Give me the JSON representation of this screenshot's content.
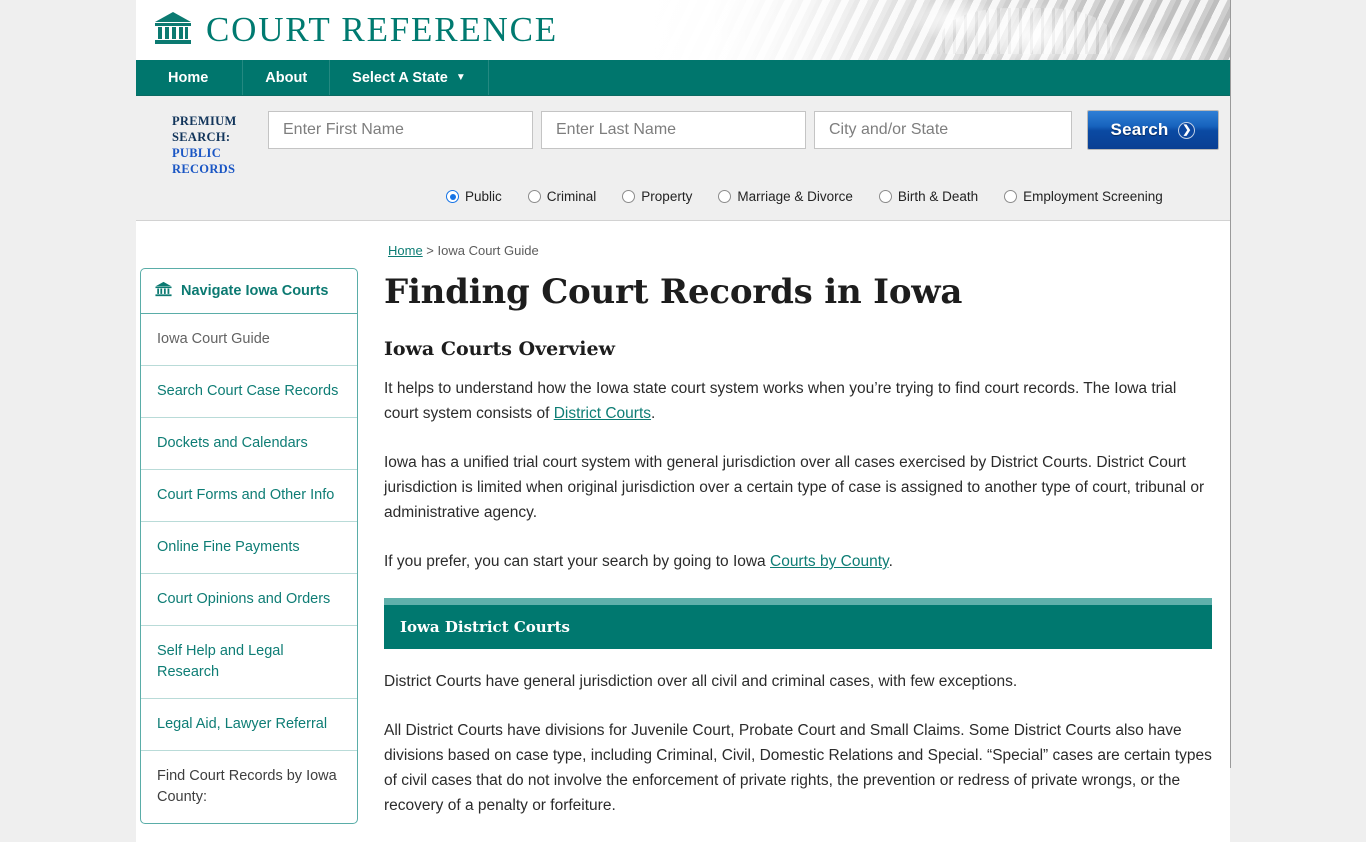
{
  "site": {
    "brand": "COURT REFERENCE",
    "brand_icon": "courthouse-icon"
  },
  "nav": {
    "items": [
      {
        "label": "Home"
      },
      {
        "label": "About"
      },
      {
        "label": "Select A State",
        "caret": "▼"
      }
    ]
  },
  "premium_search": {
    "label_line1": "PREMIUM",
    "label_line2": "SEARCH:",
    "label_line3": "PUBLIC",
    "label_line4": "RECORDS",
    "first_name_placeholder": "Enter First Name",
    "first_name_value": "",
    "last_name_placeholder": "Enter Last Name",
    "last_name_value": "",
    "city_state_placeholder": "City and/or State",
    "city_state_value": "",
    "search_button": "Search",
    "search_button_icon": "chevron-right-icon",
    "options": [
      {
        "label": "Public",
        "selected": true
      },
      {
        "label": "Criminal",
        "selected": false
      },
      {
        "label": "Property",
        "selected": false
      },
      {
        "label": "Marriage & Divorce",
        "selected": false
      },
      {
        "label": "Birth & Death",
        "selected": false
      },
      {
        "label": "Employment Screening",
        "selected": false
      }
    ]
  },
  "sidebar": {
    "heading": "Navigate Iowa Courts",
    "heading_icon": "courthouse-icon",
    "items": [
      {
        "label": "Iowa Court Guide",
        "state": "current"
      },
      {
        "label": "Search Court Case Records",
        "state": "link"
      },
      {
        "label": "Dockets and Calendars",
        "state": "link"
      },
      {
        "label": "Court Forms and Other Info",
        "state": "link"
      },
      {
        "label": "Online Fine Payments",
        "state": "link"
      },
      {
        "label": "Court Opinions and Orders",
        "state": "link"
      },
      {
        "label": "Self Help and Legal Research",
        "state": "link"
      },
      {
        "label": "Legal Aid, Lawyer Referral",
        "state": "link"
      },
      {
        "label": "Find Court Records by Iowa County:",
        "state": "plain"
      }
    ]
  },
  "breadcrumb": {
    "home": "Home",
    "separator": " > ",
    "current": "Iowa Court Guide"
  },
  "main": {
    "title": "Finding Court Records in Iowa",
    "overview_heading": "Iowa Courts Overview",
    "para1_before": "It helps to understand how the Iowa state court system works when you’re trying to find court records. The Iowa trial court system consists of ",
    "para1_link": "District Courts",
    "para1_after": ".",
    "para2": "Iowa has a unified trial court system with general jurisdiction over all cases exercised by District Courts. District Court jurisdiction is limited when original jurisdiction over a certain type of case is assigned to another type of court, tribunal or administrative agency.",
    "para3_before": "If you prefer, you can start your search by going to Iowa ",
    "para3_link": "Courts by County",
    "para3_after": ".",
    "section_heading": "Iowa District Courts",
    "para4": "District Courts have general jurisdiction over all civil and criminal cases, with few exceptions.",
    "para5": "All District Courts have divisions for Juvenile Court, Probate Court and Small Claims. Some District Courts also have divisions based on case type, including Criminal, Civil, Domestic Relations and Special. “Special” cases are certain types of civil cases that do not involve the enforcement of private rights, the prevention or redress of private wrongs, or the recovery of a penalty or forfeiture."
  },
  "colors": {
    "teal": "#00766d",
    "teal_light": "#5fb0ab",
    "link": "#0e7d75",
    "button_blue": "#0a4aa3",
    "page_bg": "#efefef"
  }
}
